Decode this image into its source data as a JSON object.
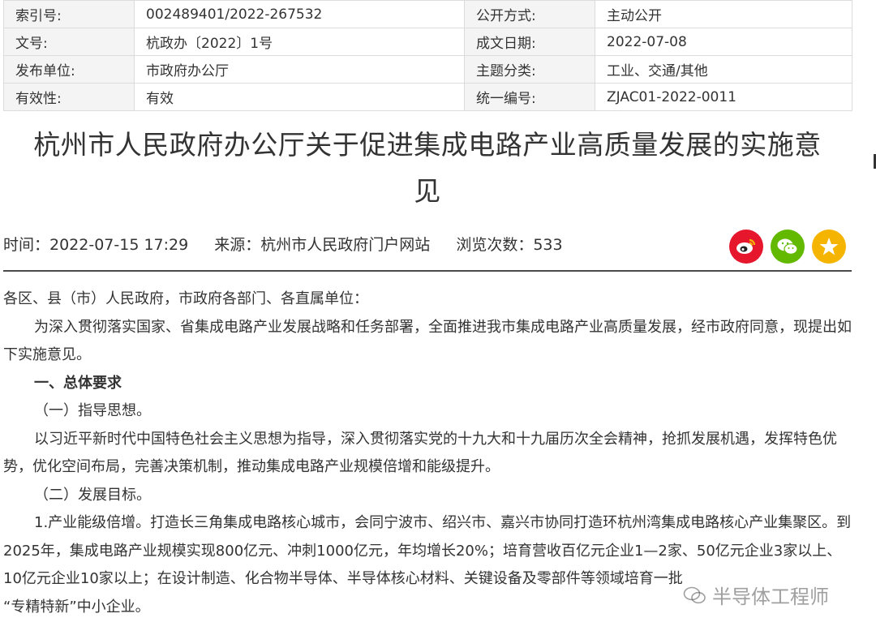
{
  "meta": {
    "rows": [
      [
        {
          "k": "索引号:",
          "v": "002489401/2022-267532"
        },
        {
          "k": "公开方式:",
          "v": "主动公开"
        }
      ],
      [
        {
          "k": "文号:",
          "v": "杭政办〔2022〕1号"
        },
        {
          "k": "成文日期:",
          "v": "2022-07-08"
        }
      ],
      [
        {
          "k": "发布单位:",
          "v": "市政府办公厅"
        },
        {
          "k": "主题分类:",
          "v": "工业、交通/其他"
        }
      ],
      [
        {
          "k": "有效性:",
          "v": "有效"
        },
        {
          "k": "统一编号:",
          "v": "ZJAC01-2022-0011"
        }
      ]
    ]
  },
  "title": {
    "line1": "杭州市人民政府办公厅关于促进集成电路产业高质量发展的实施意",
    "line2": "见"
  },
  "info": {
    "time": "时间：2022-07-15 17:29",
    "source": "来源：杭州市人民政府门户网站",
    "views": "浏览次数：533"
  },
  "share": {
    "icons": [
      "weibo-icon",
      "wechat-icon",
      "star-icon"
    ]
  },
  "content": {
    "addressee": "各区、县（市）人民政府，市政府各部门、各直属单位：",
    "intro": "为深入贯彻落实国家、省集成电路产业发展战略和任务部署，全面推进我市集成电路产业高质量发展，经市政府同意，现提出如下实施意见。",
    "section1": "一、总体要求",
    "sub1": "（一）指导思想。",
    "para1": "以习近平新时代中国特色社会主义思想为指导，深入贯彻落实党的十九大和十九届历次全会精神，抢抓发展机遇，发挥特色优势，优化空间布局，完善决策机制，推动集成电路产业规模倍增和能级提升。",
    "sub2": "（二）发展目标。",
    "para2": "1.产业能级倍增。打造长三角集成电路核心城市，会同宁波市、绍兴市、嘉兴市协同打造环杭州湾集成电路核心产业集聚区。到2025年，集成电路产业规模实现800亿元、冲刺1000亿元，年均增长20%；培育营收百亿元企业1—2家、50亿元企业3家以上、10亿元企业10家以上；在设计制造、化合物半导体、半导体核心材料、关键设备及零部件等领域培育一批",
    "para2_end": "“专精特新”中小企业。"
  },
  "watermark": {
    "text": "半导体工程师"
  },
  "colors": {
    "weibo": "#e6162d",
    "wechat": "#62b900",
    "favorite": "#f5b400"
  }
}
